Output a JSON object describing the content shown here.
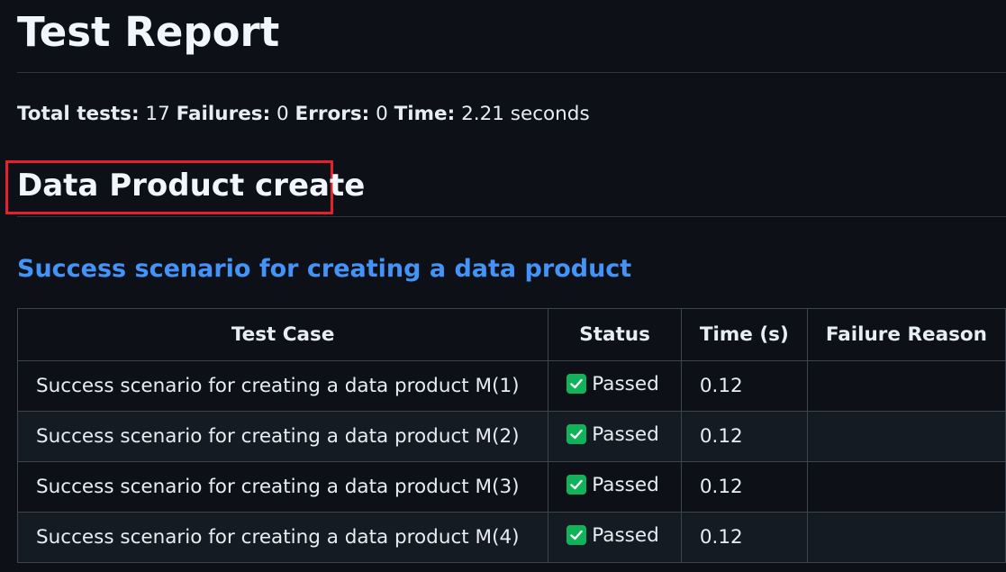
{
  "report": {
    "title": "Test Report",
    "summary": {
      "total_label": "Total tests:",
      "total_value": "17",
      "failures_label": "Failures:",
      "failures_value": "0",
      "errors_label": "Errors:",
      "errors_value": "0",
      "time_label": "Time:",
      "time_value": "2.21 seconds"
    },
    "section": {
      "title": "Data Product create",
      "highlight_color": "#e5202d",
      "subsection_title": "Success scenario for creating a data product",
      "table": {
        "headers": [
          "Test Case",
          "Status",
          "Time (s)",
          "Failure Reason"
        ],
        "rows": [
          {
            "test_case": "Success scenario for creating a data product M(1)",
            "status_icon": "check-icon",
            "status": "Passed",
            "time": "0.12",
            "failure_reason": ""
          },
          {
            "test_case": "Success scenario for creating a data product M(2)",
            "status_icon": "check-icon",
            "status": "Passed",
            "time": "0.12",
            "failure_reason": ""
          },
          {
            "test_case": "Success scenario for creating a data product M(3)",
            "status_icon": "check-icon",
            "status": "Passed",
            "time": "0.12",
            "failure_reason": ""
          },
          {
            "test_case": "Success scenario for creating a data product M(4)",
            "status_icon": "check-icon",
            "status": "Passed",
            "time": "0.12",
            "failure_reason": ""
          }
        ]
      }
    }
  },
  "colors": {
    "background": "#0d1117",
    "text": "#e6edf3",
    "link": "#4493f8",
    "passed": "#10b35a",
    "border": "#3d444d"
  }
}
